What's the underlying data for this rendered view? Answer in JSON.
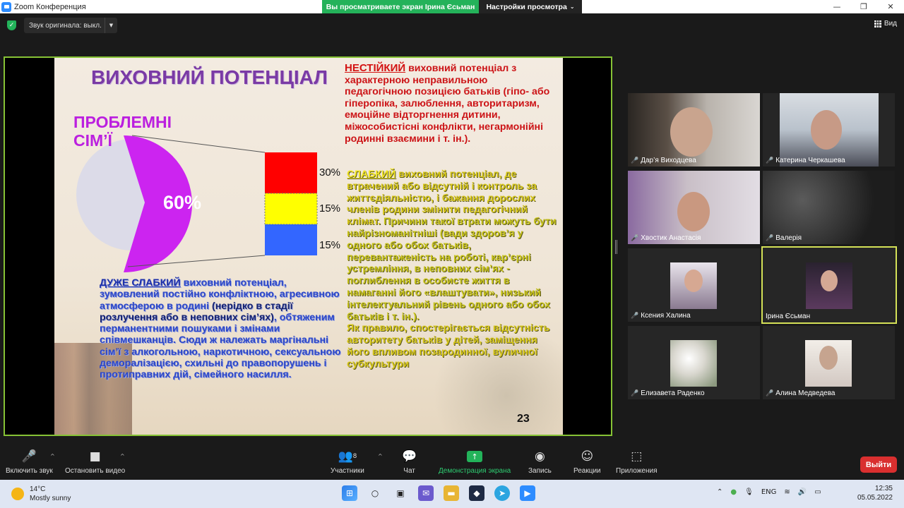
{
  "window": {
    "title": "Zoom Конференция",
    "share_banner": "Вы просматриваете экран Ірина Єсьман",
    "view_options": "Настройки просмотра",
    "minimize": "—",
    "maximize": "❐",
    "close": "✕"
  },
  "topbar": {
    "original_sound": "Звук оригинала: выкл.",
    "view_label": "Вид"
  },
  "slide": {
    "title": "ВИХОВНИЙ ПОТЕНЦІАЛ",
    "problem_label_1": "ПРОБЛЕМНІ",
    "problem_label_2": "СІМ’Ї",
    "pie_label": "60%",
    "bar_labels": [
      "30%",
      "15%",
      "15%"
    ],
    "colors": {
      "pie": "#cc24f0",
      "pie_rest": "#dcdbe8",
      "bar_red": "#ff0000",
      "bar_yellow": "#ffff00",
      "bar_blue": "#3366ff"
    },
    "unstable_heading": "НЕСТІЙКИЙ",
    "unstable_text": " виховний потенціал з характерною неправильною педагогічною позицією батьків (гіпо- або гіперопіка, залюблення, авторитаризм, емоційне відторгнення дитини, міжособистісні конфлікти, негармонійні родинні взаємини і т. ін.).",
    "weak_heading": "СЛАБКИЙ",
    "weak_text": " виховний потенціал, де втрачений або відсутній і контроль за життєдіяльністю, і бажання дорослих членів родини змінити педагогічний клімат. ",
    "weak_text_2": "Причини такої втрати можуть бути найрізноманітніші (вади здоров’я у одного або обох батьків, перевантаженість на роботі, кар’єрні устремління, в неповних сім’ях - поглиблення в особисте життя в намаганні його «влаштувати», низький інтелектуальний рівень одного або обох батьків і т. ін.).",
    "weak_text_3": "Як правило, спостерігається відсутність авторитету батьків у дітей, заміщення його впливом позародинної, вуличної субкультури",
    "very_weak_heading": "ДУЖЕ СЛАБКИЙ",
    "very_weak_text": " виховний потенціал, зумовлений постійно конфліктною, агресивною атмосферою в родині ",
    "very_weak_text_2": "(нерідко в стадії розлучення або в неповних сім’ях)",
    "very_weak_text_3": ", обтяженим перманентними пошуками і змінами співмешканців. Сюди ж належать маргінальні сім’ї з алкогольною, наркотичною, сексуальною деморалізацією, схильні до правопорушень і протиправних дій, сімейного насилля.",
    "page_number": "23"
  },
  "participants": [
    {
      "name": "Дар’я Виходцева",
      "muted": true
    },
    {
      "name": "Катерина Черкашева",
      "muted": true
    },
    {
      "name": "Хвостик Анастасія",
      "muted": true
    },
    {
      "name": "Валерія",
      "muted": true
    },
    {
      "name": "Ксения Халина",
      "muted": true
    },
    {
      "name": "Ірина Єсьман",
      "muted": false
    },
    {
      "name": "Елизавета Раденко",
      "muted": true
    },
    {
      "name": "Алина Медведева",
      "muted": true
    }
  ],
  "toolbar": {
    "mute": "Включить звук",
    "video": "Остановить видео",
    "participants": "Участники",
    "participants_count": "8",
    "chat": "Чат",
    "share": "Демонстрация экрана",
    "record": "Запись",
    "reactions": "Реакции",
    "apps": "Приложения",
    "leave": "Выйти"
  },
  "taskbar": {
    "temp": "14°C",
    "weather": "Mostly sunny",
    "lang": "ENG",
    "time": "12:35",
    "date": "05.05.2022"
  }
}
